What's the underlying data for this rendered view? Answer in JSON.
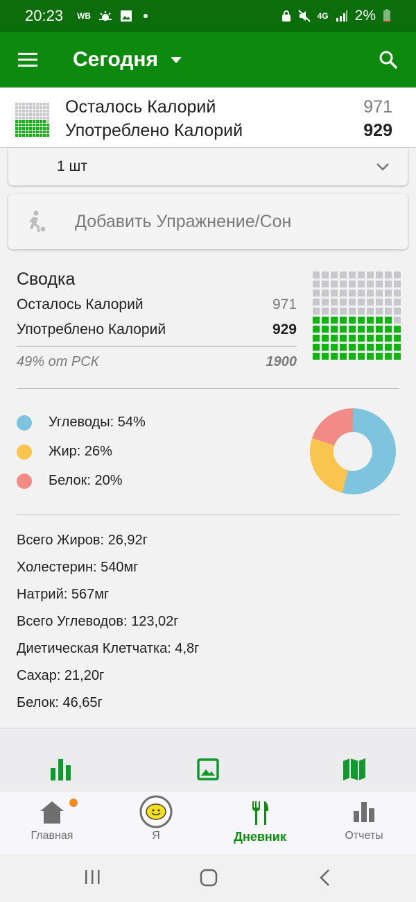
{
  "status_bar": {
    "time": "20:23",
    "wb": "WB",
    "network": "4G",
    "battery": "2%"
  },
  "app_bar": {
    "title": "Сегодня"
  },
  "calorie_bar": {
    "remaining_label": "Осталось Калорий",
    "remaining_value": "971",
    "consumed_label": "Употреблено Калорий",
    "consumed_value": "929"
  },
  "serving": {
    "value": "1 шт"
  },
  "add_exercise": {
    "label": "Добавить Упражнение/Сон"
  },
  "summary": {
    "title": "Сводка",
    "remaining_label": "Осталось Калорий",
    "remaining_value": "971",
    "consumed_label": "Употреблено Калорий",
    "consumed_value": "929",
    "rsk_label": "49% от РСК",
    "rsk_value": "1900",
    "consumed_fraction": 0.49
  },
  "macros": [
    {
      "label": "Углеводы: 54%",
      "percent": 54,
      "color": "#7ec4de"
    },
    {
      "label": "Жир: 26%",
      "percent": 26,
      "color": "#f9c54f"
    },
    {
      "label": "Белок: 20%",
      "percent": 20,
      "color": "#f28b86"
    }
  ],
  "nutrients": [
    "Всего Жиров: 26,92г",
    "Холестерин: 540мг",
    "Натрий: 567мг",
    "Всего Углеводов: 123,02г",
    "Диетическая Клетчатка: 4,8г",
    "Сахар: 21,20г",
    "Белок: 46,65г"
  ],
  "quick_actions": [
    "bar-chart-icon",
    "image-icon",
    "map-icon"
  ],
  "tabs": [
    {
      "label": "Главная",
      "icon": "home-icon"
    },
    {
      "label": "Я",
      "icon": "avatar-icon"
    },
    {
      "label": "Дневник",
      "icon": "fork-knife-icon",
      "active": true
    },
    {
      "label": "Отчеты",
      "icon": "reports-icon"
    }
  ],
  "colors": {
    "status_bar": "#0b6e0b",
    "app_bar": "#0d8a0d",
    "accent_green": "#10b410",
    "badge": "#f28a1c"
  }
}
